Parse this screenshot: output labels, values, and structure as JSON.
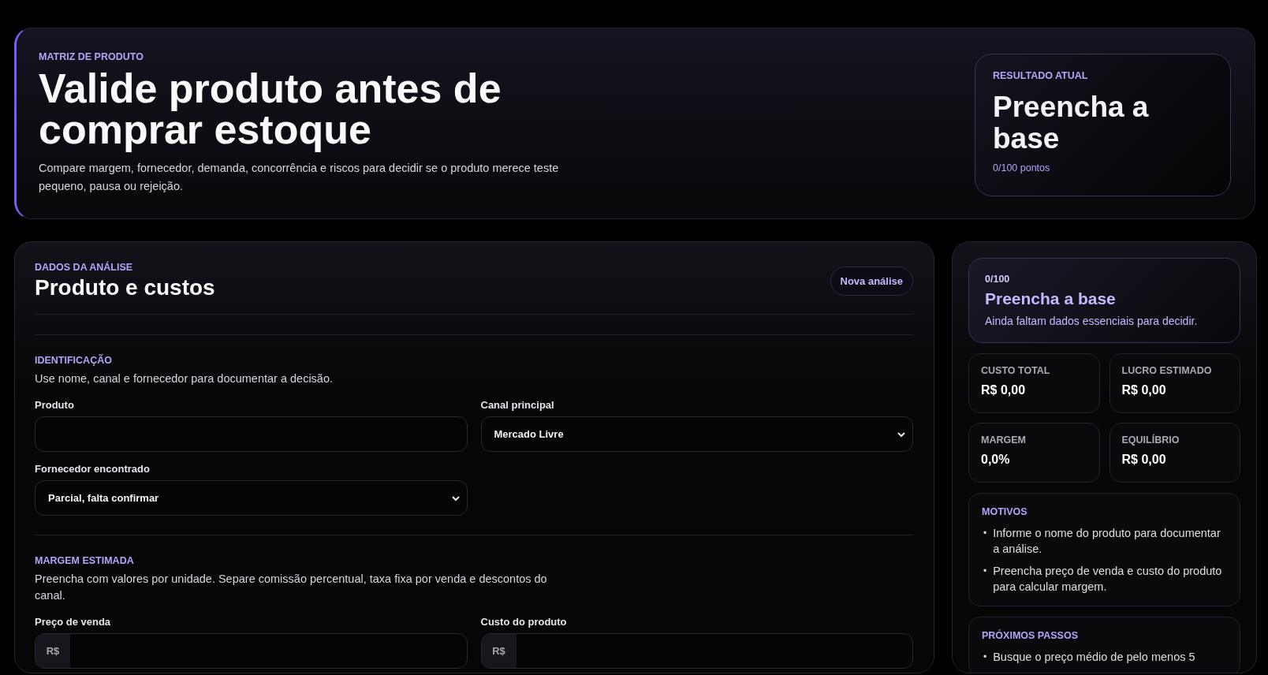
{
  "hero": {
    "eyebrow": "MATRIZ DE PRODUTO",
    "title": "Valide produto antes de comprar estoque",
    "description": "Compare margem, fornecedor, demanda, concorrência e riscos para decidir se o produto merece teste pequeno, pausa ou rejeição.",
    "result": {
      "label": "RESULTADO ATUAL",
      "title": "Preencha a base",
      "points": "0/100 pontos"
    }
  },
  "form": {
    "eyebrow": "DADOS DA ANÁLISE",
    "title": "Produto e custos",
    "button": "Nova análise",
    "sections": [
      {
        "title": "IDENTIFICAÇÃO",
        "description": "Use nome, canal e fornecedor para documentar a decisão.",
        "fields": [
          {
            "kind": "text",
            "label": "Produto"
          },
          {
            "kind": "select",
            "label": "Canal principal",
            "value": "Mercado Livre"
          },
          {
            "kind": "select",
            "label": "Fornecedor encontrado",
            "value": "Parcial, falta confirmar"
          }
        ]
      },
      {
        "title": "MARGEM ESTIMADA",
        "description": "Preencha com valores por unidade. Separe comissão percentual, taxa fixa por venda e descontos do canal.",
        "fields": [
          {
            "kind": "money",
            "label": "Preço de venda",
            "prefix": "R$"
          },
          {
            "kind": "money",
            "label": "Custo do produto",
            "prefix": "R$"
          }
        ]
      }
    ]
  },
  "summary": {
    "score": "0/100",
    "title": "Preencha a base",
    "description": "Ainda faltam dados essenciais para decidir.",
    "stats": [
      {
        "label": "CUSTO TOTAL",
        "value": "R$ 0,00"
      },
      {
        "label": "LUCRO ESTIMADO",
        "value": "R$ 0,00"
      },
      {
        "label": "MARGEM",
        "value": "0,0%"
      },
      {
        "label": "EQUILÍBRIO",
        "value": "R$ 0,00"
      }
    ],
    "lists": [
      {
        "title": "MOTIVOS",
        "items": [
          {
            "bullet": "•",
            "text": "Informe o nome do produto para documentar a análise."
          },
          {
            "bullet": "•",
            "text": "Preencha preço de venda e custo do produto para calcular margem."
          }
        ]
      },
      {
        "title": "PRÓXIMOS PASSOS",
        "items": [
          {
            "bullet": "•",
            "text": "Busque o preço médio de pelo menos 5"
          }
        ]
      }
    ]
  }
}
